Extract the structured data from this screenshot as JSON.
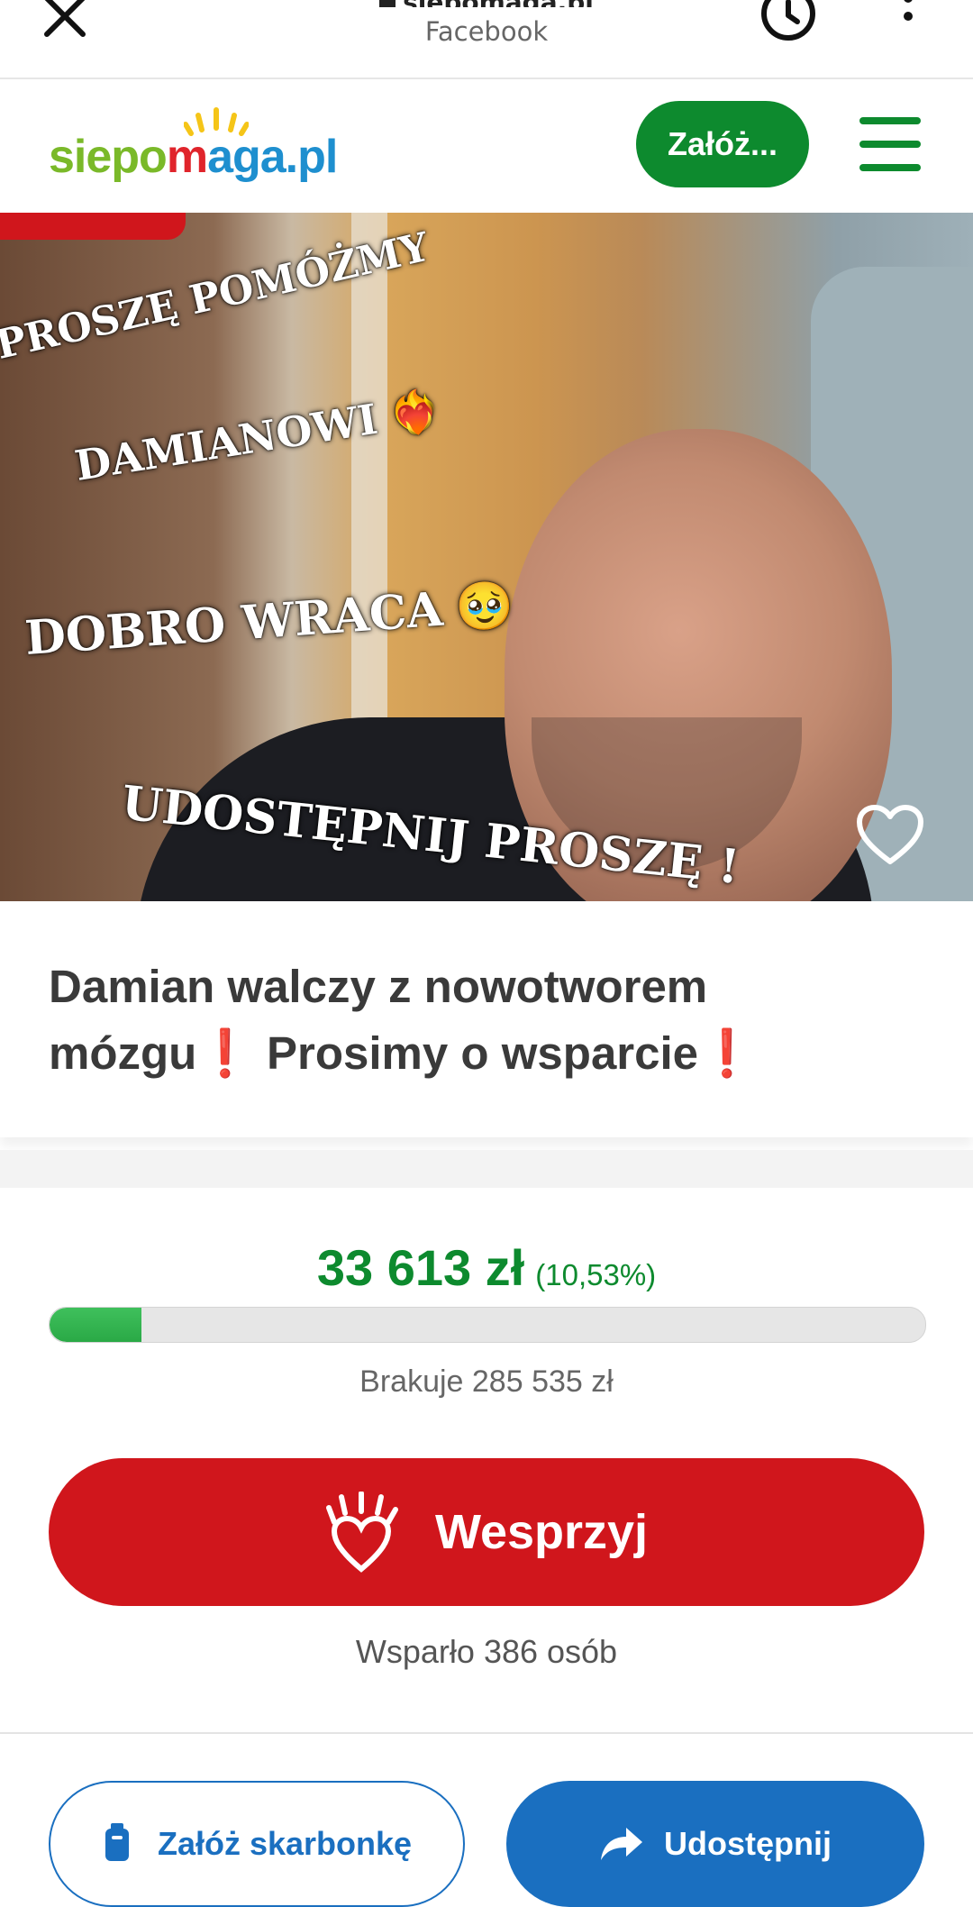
{
  "browser": {
    "url": "siepomaga.pl",
    "source": "Facebook"
  },
  "header": {
    "logo": {
      "part1": "siepo",
      "part2": "m",
      "part3": "aga.pl"
    },
    "cta_label": "Załóż..."
  },
  "hero": {
    "overlay_lines": [
      "PROSZĘ POMÓŻMY",
      "DAMIANOWI",
      "DOBRO WRACA",
      "UDOSTĘPNIJ PROSZĘ !"
    ],
    "emojis": {
      "heart": "❤️‍🔥",
      "tears": "🥹"
    }
  },
  "fundraiser": {
    "title_part1": "Damian walczy z nowotworem mózgu",
    "title_part2": "Prosimy o wsparcie",
    "exclamation": "❗",
    "raised": "33 613 zł",
    "percent_text": "(10,53%)",
    "percent_value": 10.53,
    "missing": "Brakuje 285 535 zł",
    "support_label": "Wesprzyj",
    "supporters": "Wsparło 386 osób"
  },
  "actions": {
    "piggy_label": "Załóż skarbonkę",
    "share_label": "Udostępnij"
  },
  "colors": {
    "green": "#0d8a2e",
    "red": "#d0161c",
    "blue": "#1a6fc0"
  }
}
